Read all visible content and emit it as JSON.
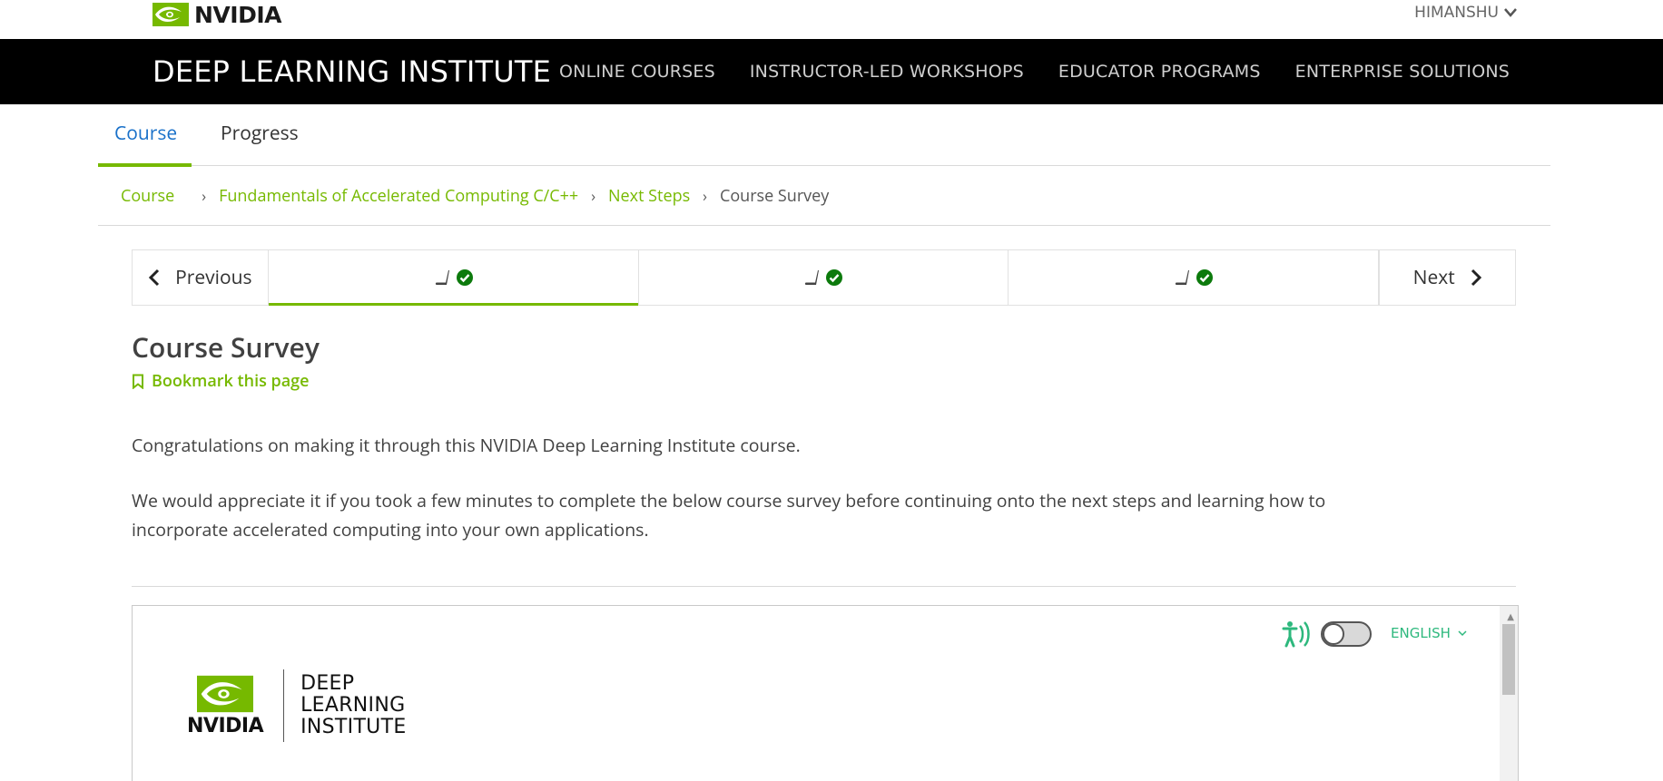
{
  "header": {
    "brand_word": "NVIDIA",
    "user_name": "HIMANSHU"
  },
  "nav": {
    "site_title": "DEEP LEARNING INSTITUTE",
    "links": [
      "ONLINE COURSES",
      "INSTRUCTOR-LED WORKSHOPS",
      "EDUCATOR PROGRAMS",
      "ENTERPRISE SOLUTIONS"
    ]
  },
  "tabs": [
    {
      "label": "Course",
      "active": true
    },
    {
      "label": "Progress",
      "active": false
    }
  ],
  "breadcrumb": {
    "items": [
      "Course",
      "Fundamentals of Accelerated Computing C/C++",
      "Next Steps"
    ],
    "current": "Course Survey"
  },
  "sequence": {
    "previous_label": "Previous",
    "next_label": "Next",
    "active_index": 0,
    "item_icons": [
      "book-icon",
      "check-circle-icon"
    ]
  },
  "content": {
    "title": "Course Survey",
    "bookmark_label": "Bookmark this page",
    "paragraph1": "Congratulations on making it through this NVIDIA Deep Learning Institute course.",
    "paragraph2": "We would appreciate it if you took a few minutes to complete the below course survey before continuing onto the next steps and learning how to incorporate accelerated computing into your own applications."
  },
  "survey": {
    "language": "ENGLISH",
    "accessibility_toggle": "off",
    "logo_word": "NVIDIA",
    "logo_text_lines": [
      "DEEP",
      "LEARNING",
      "INSTITUTE"
    ]
  },
  "colors": {
    "nvidia_green": "#76b900",
    "tab_active_text": "#1a71c9",
    "nav_bg": "#000000",
    "survey_accent": "#2db87d",
    "check_green": "#0c7a0c"
  }
}
